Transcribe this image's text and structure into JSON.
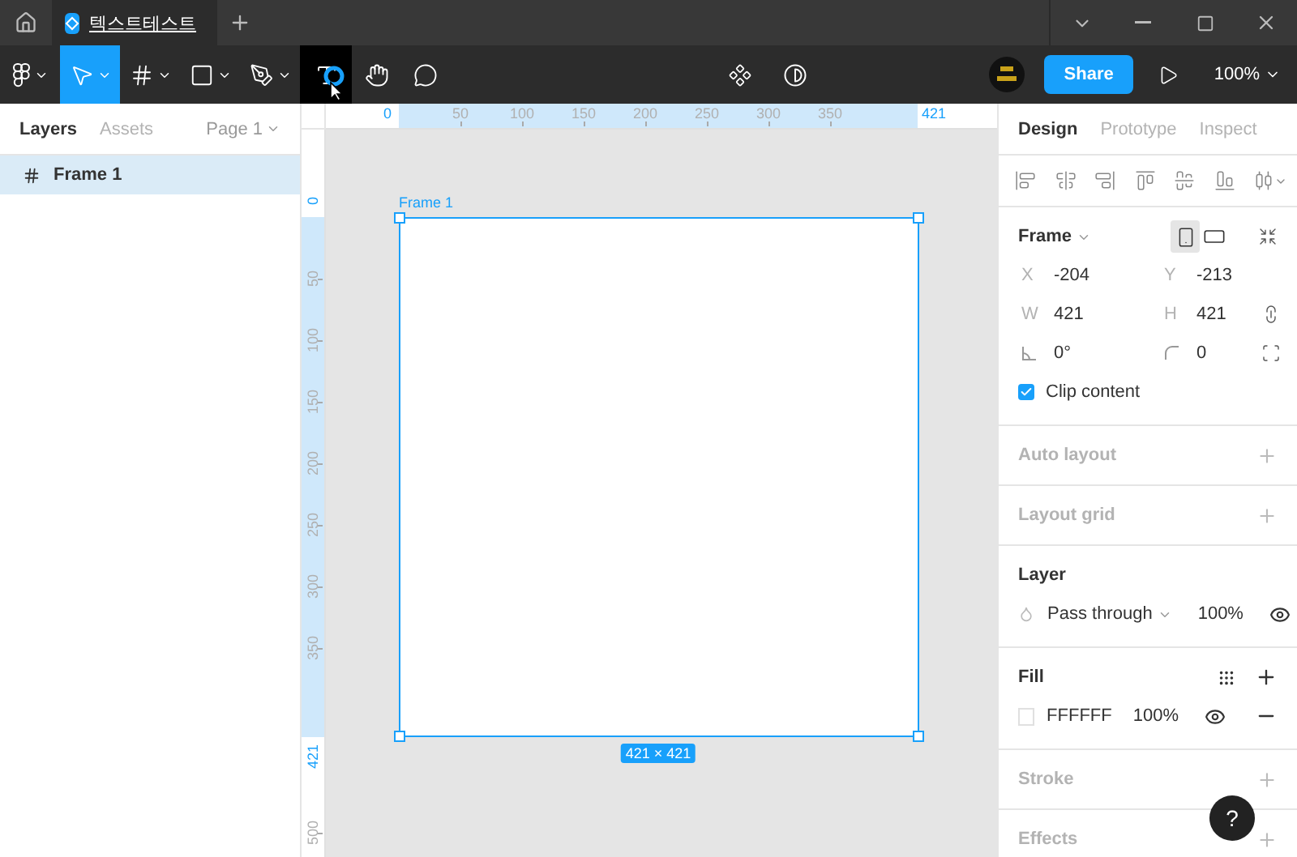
{
  "title_bar": {
    "tabs": [
      {
        "title": "텍스트테스트",
        "selected": true
      }
    ]
  },
  "toolbar": {
    "tools": [
      {
        "kind": "main-menu",
        "selected": false,
        "hovered": false,
        "dropdown": true
      },
      {
        "kind": "move",
        "selected": true,
        "hovered": false,
        "dropdown": true
      },
      {
        "kind": "frame",
        "selected": false,
        "hovered": false,
        "dropdown": true
      },
      {
        "kind": "shape",
        "selected": false,
        "hovered": false,
        "dropdown": true
      },
      {
        "kind": "pen",
        "selected": false,
        "hovered": false,
        "dropdown": true
      },
      {
        "kind": "text",
        "selected": false,
        "hovered": true,
        "dropdown": false
      },
      {
        "kind": "hand",
        "selected": false,
        "hovered": false,
        "dropdown": false
      },
      {
        "kind": "comment",
        "selected": false,
        "hovered": false,
        "dropdown": false
      }
    ],
    "share": "Share",
    "zoom": "100%"
  },
  "left_panel": {
    "tabs": [
      {
        "label": "Layers",
        "selected": true
      },
      {
        "label": "Assets",
        "selected": false
      }
    ],
    "page": "Page 1",
    "layers": [
      {
        "name": "Frame 1",
        "selected": true
      }
    ]
  },
  "canvas": {
    "top_ruler": [
      {
        "text": "0",
        "kind": "edge"
      },
      {
        "text": "50",
        "kind": "tick"
      },
      {
        "text": "100",
        "kind": "tick"
      },
      {
        "text": "150",
        "kind": "tick"
      },
      {
        "text": "200",
        "kind": "tick"
      },
      {
        "text": "250",
        "kind": "tick"
      },
      {
        "text": "300",
        "kind": "tick"
      },
      {
        "text": "350",
        "kind": "tick"
      },
      {
        "text": "421",
        "kind": "edge"
      }
    ],
    "left_ruler": [
      {
        "text": "0",
        "kind": "edge"
      },
      {
        "text": "50",
        "kind": "tick"
      },
      {
        "text": "100",
        "kind": "tick"
      },
      {
        "text": "150",
        "kind": "tick"
      },
      {
        "text": "200",
        "kind": "tick"
      },
      {
        "text": "250",
        "kind": "tick"
      },
      {
        "text": "300",
        "kind": "tick"
      },
      {
        "text": "350",
        "kind": "tick"
      },
      {
        "text": "421",
        "kind": "edge"
      },
      {
        "text": "500",
        "kind": "tick"
      }
    ],
    "frame": {
      "name": "Frame 1",
      "size": "421 × 421",
      "selected": true
    }
  },
  "design_panel": {
    "tabs": [
      {
        "label": "Design",
        "selected": true
      },
      {
        "label": "Prototype",
        "selected": false
      },
      {
        "label": "Inspect",
        "selected": false
      }
    ],
    "frame": {
      "title": "Frame",
      "orientations": [
        {
          "kind": "portrait",
          "selected": true
        },
        {
          "kind": "landscape",
          "selected": false
        }
      ],
      "fields": [
        {
          "kind": "text",
          "label": "X",
          "value": "-204"
        },
        {
          "kind": "text",
          "label": "Y",
          "value": "-213"
        },
        {
          "kind": "text",
          "label": "W",
          "value": "421"
        },
        {
          "kind": "text",
          "label": "H",
          "value": "421"
        },
        {
          "kind": "rotation",
          "value": "0°"
        },
        {
          "kind": "radius",
          "value": "0"
        }
      ],
      "clip_content": {
        "label": "Clip content",
        "checked": true
      }
    },
    "auto_layout": {
      "title": "Auto layout"
    },
    "layout_grid": {
      "title": "Layout grid"
    },
    "layer": {
      "title": "Layer",
      "blend": "Pass through",
      "opacity": "100%",
      "visible": true
    },
    "fill": {
      "title": "Fill",
      "items": [
        {
          "hex": "FFFFFF",
          "opacity": "100%",
          "visible": true
        }
      ]
    },
    "stroke": {
      "title": "Stroke"
    },
    "effects": {
      "title": "Effects"
    }
  },
  "help": "?"
}
